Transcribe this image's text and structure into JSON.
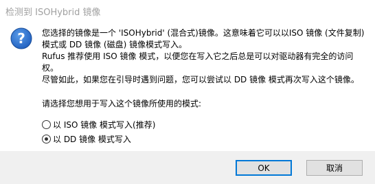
{
  "window": {
    "title": "检测到 ISOHybrid 镜像"
  },
  "message": {
    "icon": "question-icon",
    "paragraph1": "您选择的镜像是一个 'ISOHybrid' (混合式)镜像。这意味着它可以以ISO 镜像 (文件复制)模式或 DD 镜像 (磁盘) 镜像模式写入。",
    "paragraph2": "Rufus 推荐使用 ISO 镜像 模式，以便您在写入它之后总是可以对驱动器有完全的访问权。",
    "paragraph3": "尽管如此，如果您在引导时遇到问题，您可以尝试以 DD 镜像 模式再次写入这个镜像。",
    "prompt": "请选择您想用于写入这个镜像所使用的模式:"
  },
  "options": [
    {
      "label": "以 ISO 镜像 模式写入(推荐)",
      "selected": false
    },
    {
      "label": "以 DD 镜像 模式写入",
      "selected": true
    }
  ],
  "buttons": {
    "ok": "OK",
    "cancel": "取消"
  },
  "colors": {
    "accent": "#0078d7",
    "icon_blue": "#1f5fbf",
    "footer": "#f0f0f0"
  }
}
